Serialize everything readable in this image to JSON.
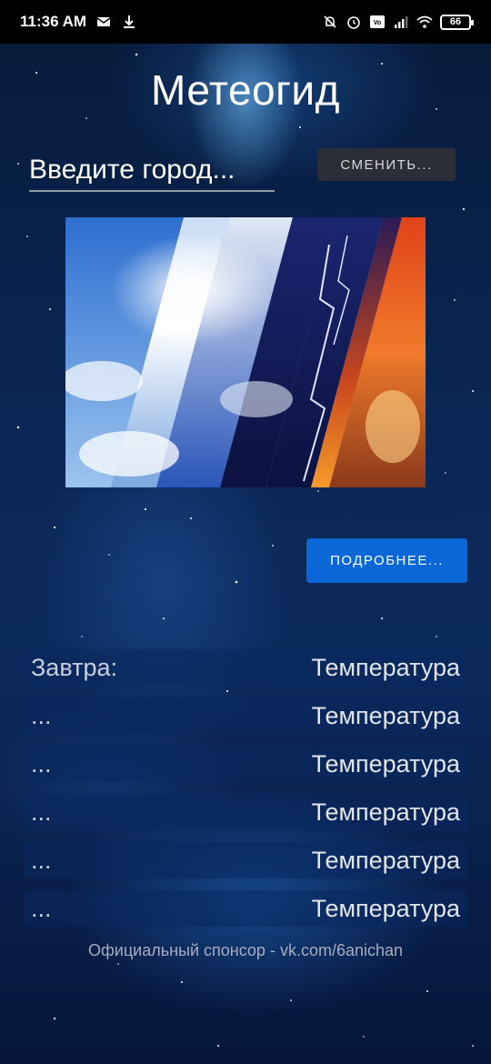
{
  "status_bar": {
    "time": "11:36 AM",
    "battery": "66",
    "icons_left": [
      "mail-icon",
      "download-icon"
    ],
    "icons_right": [
      "mute-bell-icon",
      "alarm-icon",
      "volte-icon",
      "signal-icon",
      "wifi-icon",
      "battery-icon"
    ]
  },
  "app": {
    "title": "Метеогид"
  },
  "city": {
    "placeholder": "Введите город...",
    "value": ""
  },
  "buttons": {
    "change_label": "СМЕНИТЬ...",
    "details_label": "ПОДРОБНЕЕ..."
  },
  "forecast": [
    {
      "day": "Завтра:",
      "temp": "Температура"
    },
    {
      "day": "...",
      "temp": "Температура"
    },
    {
      "day": "...",
      "temp": "Температура"
    },
    {
      "day": "...",
      "temp": "Температура"
    },
    {
      "day": "...",
      "temp": "Температура"
    },
    {
      "day": "...",
      "temp": "Температура"
    }
  ],
  "footer": {
    "sponsor": "Официальный спонсор - vk.com/6anichan"
  },
  "colors": {
    "accent": "#0a67d8",
    "secondary_button": "#2b2e36",
    "background": "#0a2552"
  }
}
